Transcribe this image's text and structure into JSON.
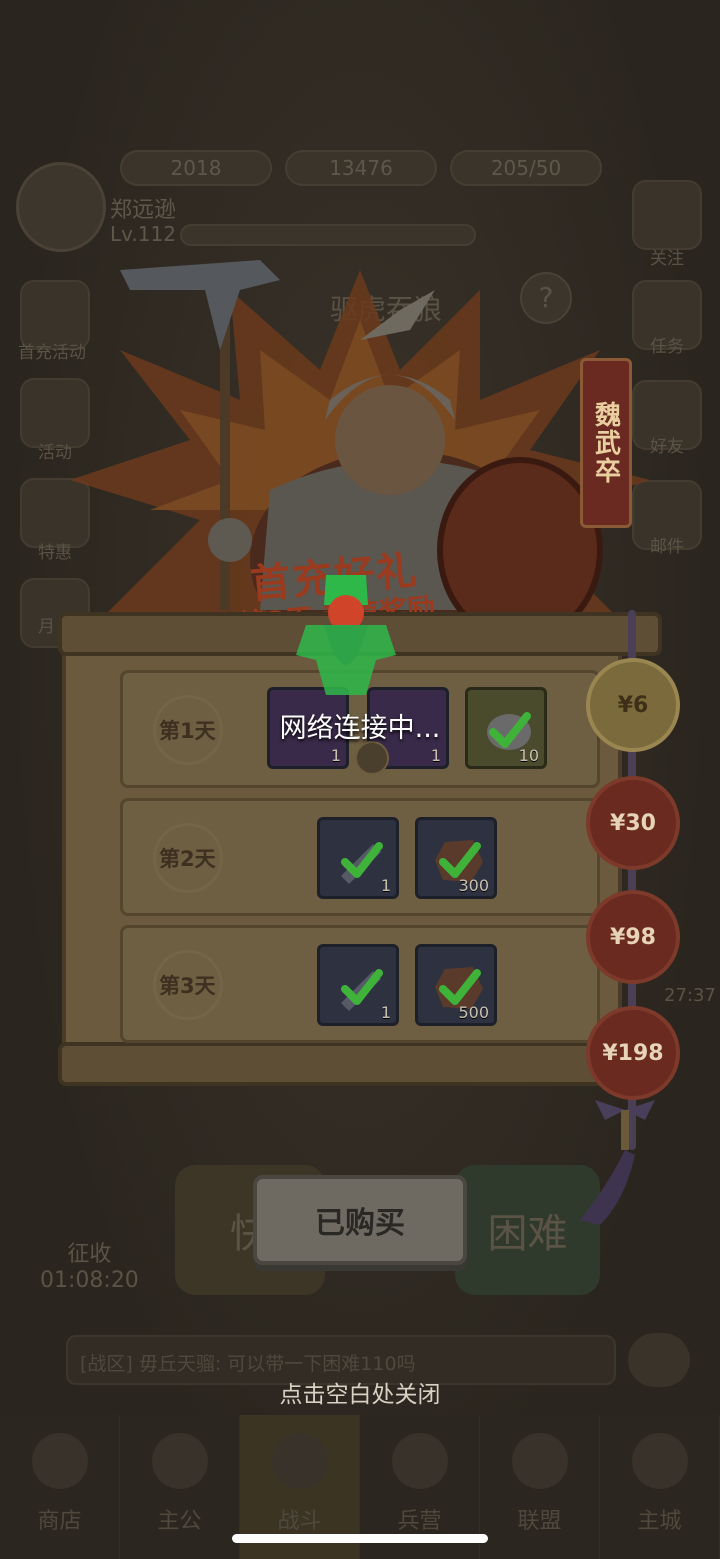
{
  "hud": {
    "resources": [
      {
        "icon": "gold-ingot-icon",
        "value": "2018"
      },
      {
        "icon": "gem-icon",
        "value": "13476"
      },
      {
        "icon": "stamina-icon",
        "value": "205/50"
      }
    ],
    "player_name": "郑远逊",
    "player_level": "Lv.112"
  },
  "side_left": [
    "首充活动",
    "活动",
    "特惠",
    "月"
  ],
  "side_right": [
    "关注",
    "任务",
    "好友",
    "邮件"
  ],
  "banner": {
    "title": "驱虎吞狼",
    "hero_name": "魏武卒",
    "gift_title": "首充好礼",
    "gift_subtitle": "连续3天 超值奖励"
  },
  "days": [
    {
      "label": "第1天",
      "items": [
        {
          "icon": "hero-card-icon",
          "qty": "1",
          "style": "purple"
        },
        {
          "icon": "hero-card-icon",
          "qty": "1",
          "style": "purple"
        },
        {
          "icon": "stone-icon",
          "qty": "10",
          "style": "olive"
        }
      ]
    },
    {
      "label": "第2天",
      "items": [
        {
          "icon": "weapon-icon",
          "qty": "1",
          "style": "blue"
        },
        {
          "icon": "ore-icon",
          "qty": "300",
          "style": "blue"
        }
      ]
    },
    {
      "label": "第3天",
      "items": [
        {
          "icon": "weapon-icon",
          "qty": "1",
          "style": "blue"
        },
        {
          "icon": "ore-icon",
          "qty": "500",
          "style": "blue"
        }
      ]
    }
  ],
  "prices": [
    {
      "label": "¥6",
      "selected": true
    },
    {
      "label": "¥30",
      "selected": false
    },
    {
      "label": "¥98",
      "selected": false
    },
    {
      "label": "¥198",
      "selected": false
    }
  ],
  "loading_text": "网络连接中...",
  "bought_button": "已购买",
  "close_hint": "点击空白处关闭",
  "modes": {
    "quick": "快",
    "hard": "困难"
  },
  "levy": {
    "label": "征收",
    "timer": "01:08:20"
  },
  "side_timer": "27:37",
  "chat_message": "[战区] 毋丘天骝: 可以带一下困难110吗",
  "nav": [
    {
      "label": "商店",
      "active": false
    },
    {
      "label": "主公",
      "active": false
    },
    {
      "label": "战斗",
      "active": true
    },
    {
      "label": "兵营",
      "active": false
    },
    {
      "label": "联盟",
      "active": false
    },
    {
      "label": "主城",
      "active": false
    }
  ],
  "colors": {
    "accent_gold": "#7a6a3c",
    "price_red": "#6a2a20",
    "check_green": "#3fb23a"
  }
}
